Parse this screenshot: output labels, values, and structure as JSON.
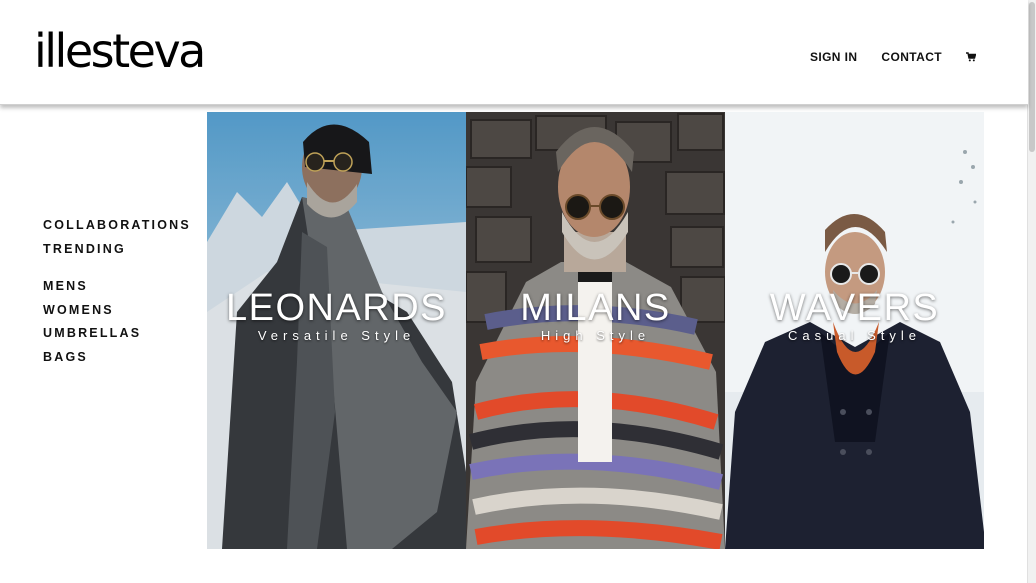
{
  "brand": {
    "logo_text": "illesteva"
  },
  "topnav": {
    "sign_in": "SIGN IN",
    "contact": "CONTACT",
    "cart_icon": "shopping-cart-icon"
  },
  "sidebar": {
    "group1": [
      "COLLABORATIONS",
      "TRENDING"
    ],
    "group2": [
      "MENS",
      "WOMENS",
      "UMBRELLAS",
      "BAGS"
    ]
  },
  "collections": [
    {
      "title": "LEONARDS",
      "subtitle": "Versatile Style"
    },
    {
      "title": "MILANS",
      "subtitle": "High Style"
    },
    {
      "title": "WAVERS",
      "subtitle": "Casual Style"
    }
  ]
}
